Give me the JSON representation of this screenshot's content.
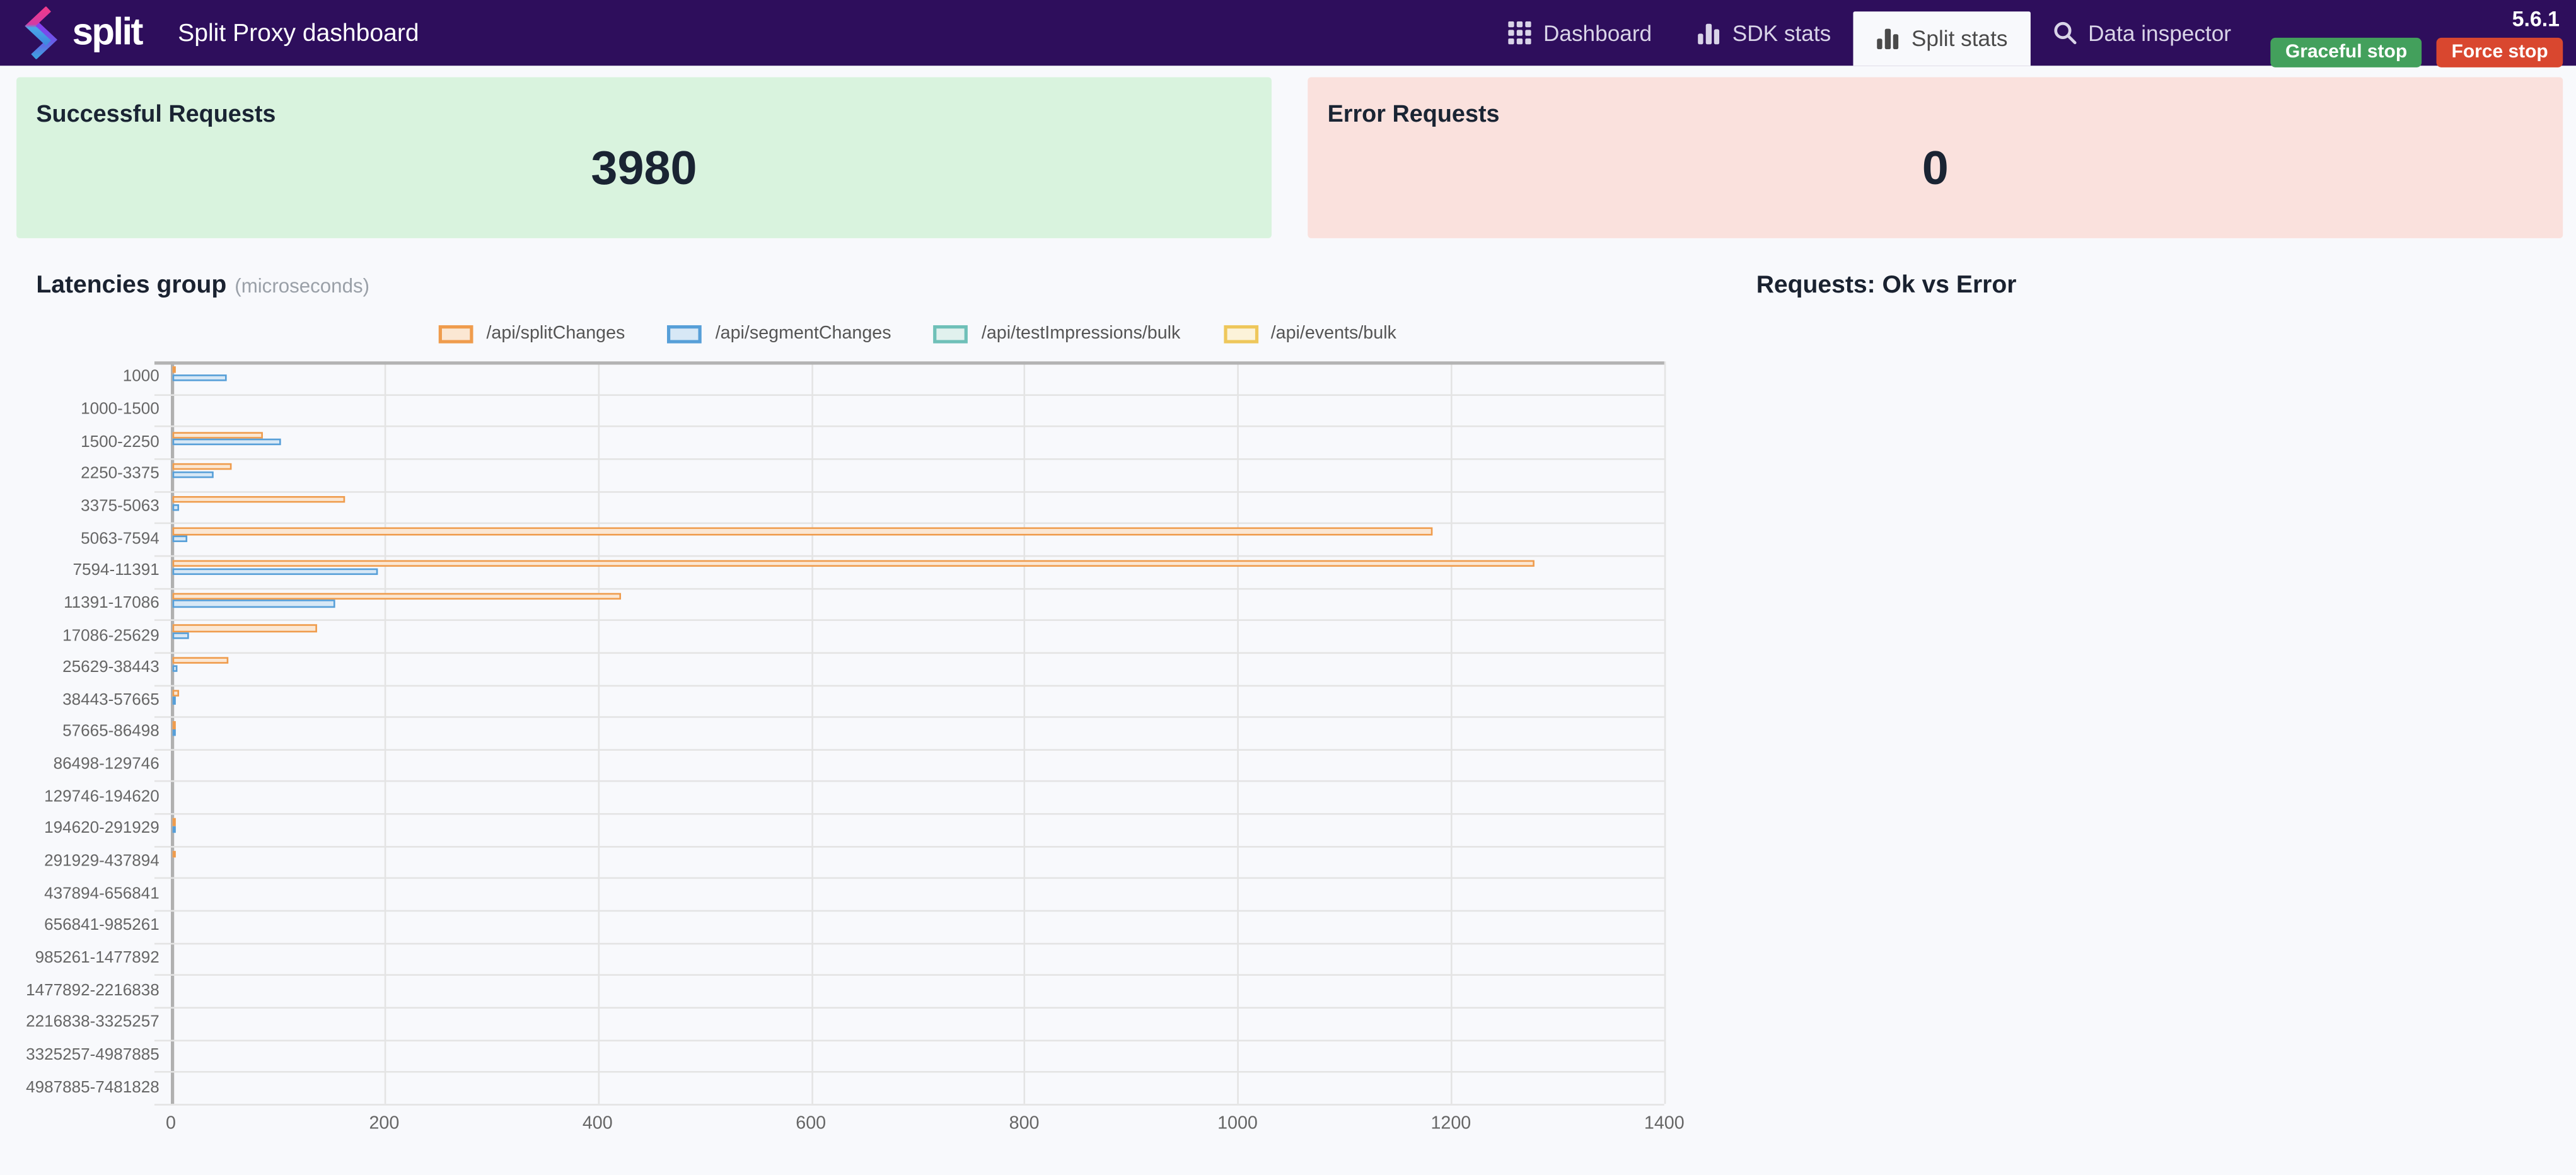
{
  "header": {
    "brand": "split",
    "title": "Split Proxy dashboard",
    "version": "5.6.1",
    "nav": [
      {
        "label": "Dashboard",
        "icon": "grid-icon",
        "active": false
      },
      {
        "label": "SDK stats",
        "icon": "bar-chart-icon",
        "active": false
      },
      {
        "label": "Split stats",
        "icon": "bar-chart-icon",
        "active": true
      },
      {
        "label": "Data inspector",
        "icon": "search-icon",
        "active": false
      }
    ],
    "buttons": {
      "graceful": {
        "label": "Graceful stop",
        "color": "#43a05c"
      },
      "force": {
        "label": "Force stop",
        "color": "#d9472f"
      }
    }
  },
  "cards": [
    {
      "title": "Successful Requests",
      "value": "3980",
      "bg": "#d9f3de"
    },
    {
      "title": "Error Requests",
      "value": "0",
      "bg": "#fae1dd"
    }
  ],
  "chart_data": [
    {
      "type": "bar",
      "orientation": "horizontal",
      "title": "Latencies group",
      "subtitle": "(microseconds)",
      "legend_position": "top",
      "grid": true,
      "xlim": [
        0,
        1400
      ],
      "x_ticks": [
        0,
        200,
        400,
        600,
        800,
        1000,
        1200,
        1400
      ],
      "categories": [
        "1000",
        "1000-1500",
        "1500-2250",
        "2250-3375",
        "3375-5063",
        "5063-7594",
        "7594-11391",
        "11391-17086",
        "17086-25629",
        "25629-38443",
        "38443-57665",
        "57665-86498",
        "86498-129746",
        "129746-194620",
        "194620-291929",
        "291929-437894",
        "437894-656841",
        "656841-985261",
        "985261-1477892",
        "1477892-2216838",
        "2216838-3325257",
        "3325257-4987885",
        "4987885-7481828"
      ],
      "series": [
        {
          "name": "/api/splitChanges",
          "border": "#ef9c4d",
          "fill": "#fbe7d3",
          "values": [
            2,
            0,
            85,
            55,
            162,
            1181,
            1277,
            420,
            135,
            52,
            6,
            3,
            0,
            0,
            2,
            1,
            0,
            0,
            0,
            0,
            0,
            0,
            0
          ]
        },
        {
          "name": "/api/segmentChanges",
          "border": "#579fd8",
          "fill": "#d7e8f6",
          "values": [
            51,
            0,
            102,
            38,
            6,
            14,
            192,
            152,
            16,
            5,
            1,
            1,
            0,
            0,
            1,
            0,
            0,
            0,
            0,
            0,
            0,
            0,
            0
          ]
        },
        {
          "name": "/api/testImpressions/bulk",
          "border": "#6fc0b8",
          "fill": "#e1f1ee",
          "values": [
            0,
            0,
            0,
            0,
            0,
            0,
            0,
            0,
            0,
            0,
            0,
            0,
            0,
            0,
            0,
            0,
            0,
            0,
            0,
            0,
            0,
            0,
            0
          ]
        },
        {
          "name": "/api/events/bulk",
          "border": "#eec75b",
          "fill": "#fcf3d9",
          "values": [
            0,
            0,
            0,
            0,
            0,
            0,
            0,
            0,
            0,
            0,
            0,
            0,
            0,
            0,
            0,
            0,
            0,
            0,
            0,
            0,
            0,
            0,
            0
          ]
        }
      ]
    },
    {
      "type": "bar",
      "title": "Requests: Ok vs Error",
      "categories": [],
      "series": []
    }
  ]
}
